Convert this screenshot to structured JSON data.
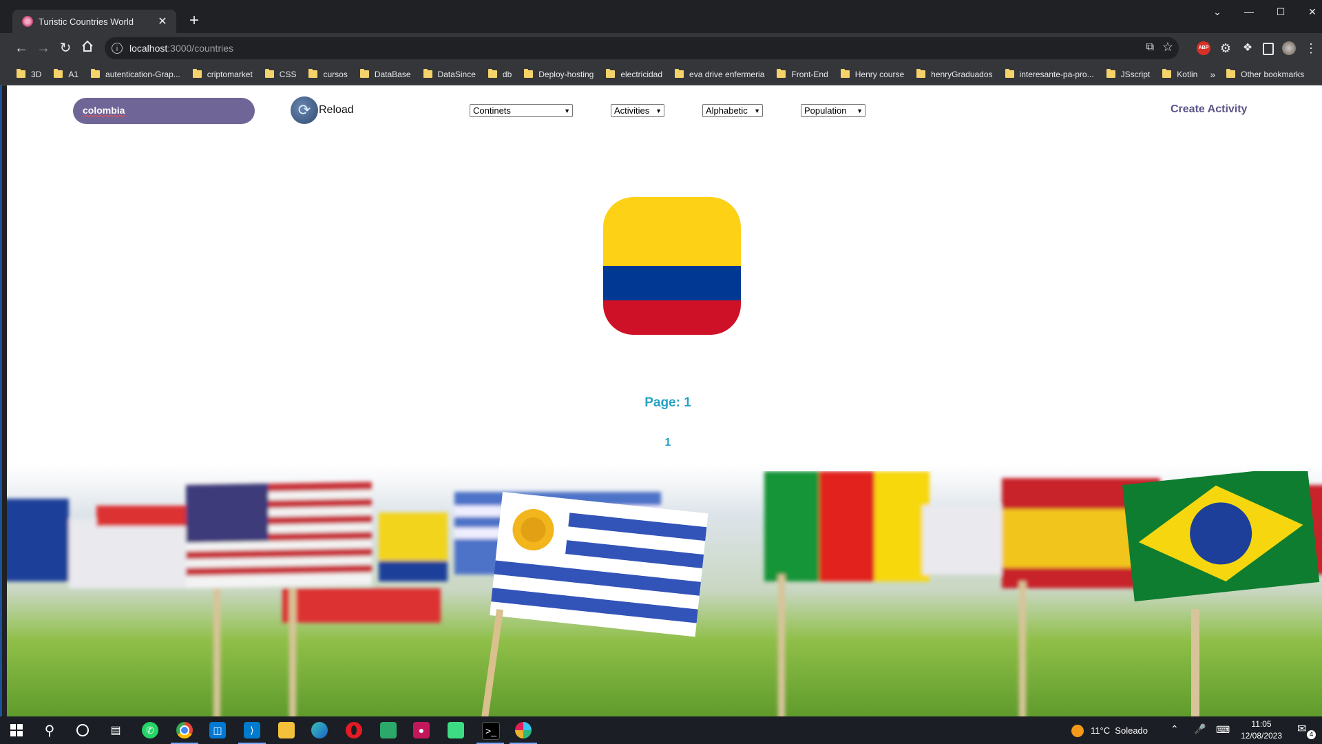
{
  "browser": {
    "tab_title": "Turistic Countries World",
    "tab_close": "✕",
    "new_tab": "+",
    "window_controls": {
      "chevron": "⌄",
      "minimize": "—",
      "maximize": "☐",
      "close": "✕"
    },
    "url_host": "localhost",
    "url_path": ":3000/countries",
    "nav_icons": [
      "back-icon",
      "forward-icon",
      "reload-icon",
      "home-icon"
    ],
    "bookmarks": [
      "3D",
      "A1",
      "autentication-Grap...",
      "criptomarket",
      "CSS",
      "cursos",
      "DataBase",
      "DataSince",
      "db",
      "Deploy-hosting",
      "electricidad",
      "eva drive enfermeria",
      "Front-End",
      "Henry course",
      "henryGraduados",
      "interesante-pa-pro...",
      "JSscript",
      "Kotlin"
    ],
    "bookmarks_overflow": "»",
    "other_bookmarks": "Other bookmarks"
  },
  "app": {
    "search_value": "colombia",
    "reload_label": "Reload",
    "filters": [
      {
        "label": "Continets"
      },
      {
        "label": "Activities"
      },
      {
        "label": "Alphabetic"
      },
      {
        "label": "Population"
      }
    ],
    "create_activity": "Create Activity",
    "flag_colors": {
      "yellow": "#fcd116",
      "blue": "#003893",
      "red": "#ce1126"
    },
    "page_label": "Page: 1",
    "page_numbers": [
      "1"
    ],
    "accent_color": "#27a2c5",
    "search_bg_color": "#6f6596"
  },
  "taskbar": {
    "weather": "11°C  Soleado",
    "time": "11:05",
    "date": "12/08/2023",
    "notification_count": "4",
    "apps": [
      "windows-start-icon",
      "search-icon",
      "cortana-icon",
      "task-view-icon",
      "whatsapp-icon",
      "chrome-icon",
      "store-icon",
      "vscode-icon",
      "file-explorer-icon",
      "edge-icon",
      "opera-icon",
      "app-icon",
      "recorder-icon",
      "android-studio-icon",
      "terminal-icon",
      "slack-icon"
    ]
  }
}
